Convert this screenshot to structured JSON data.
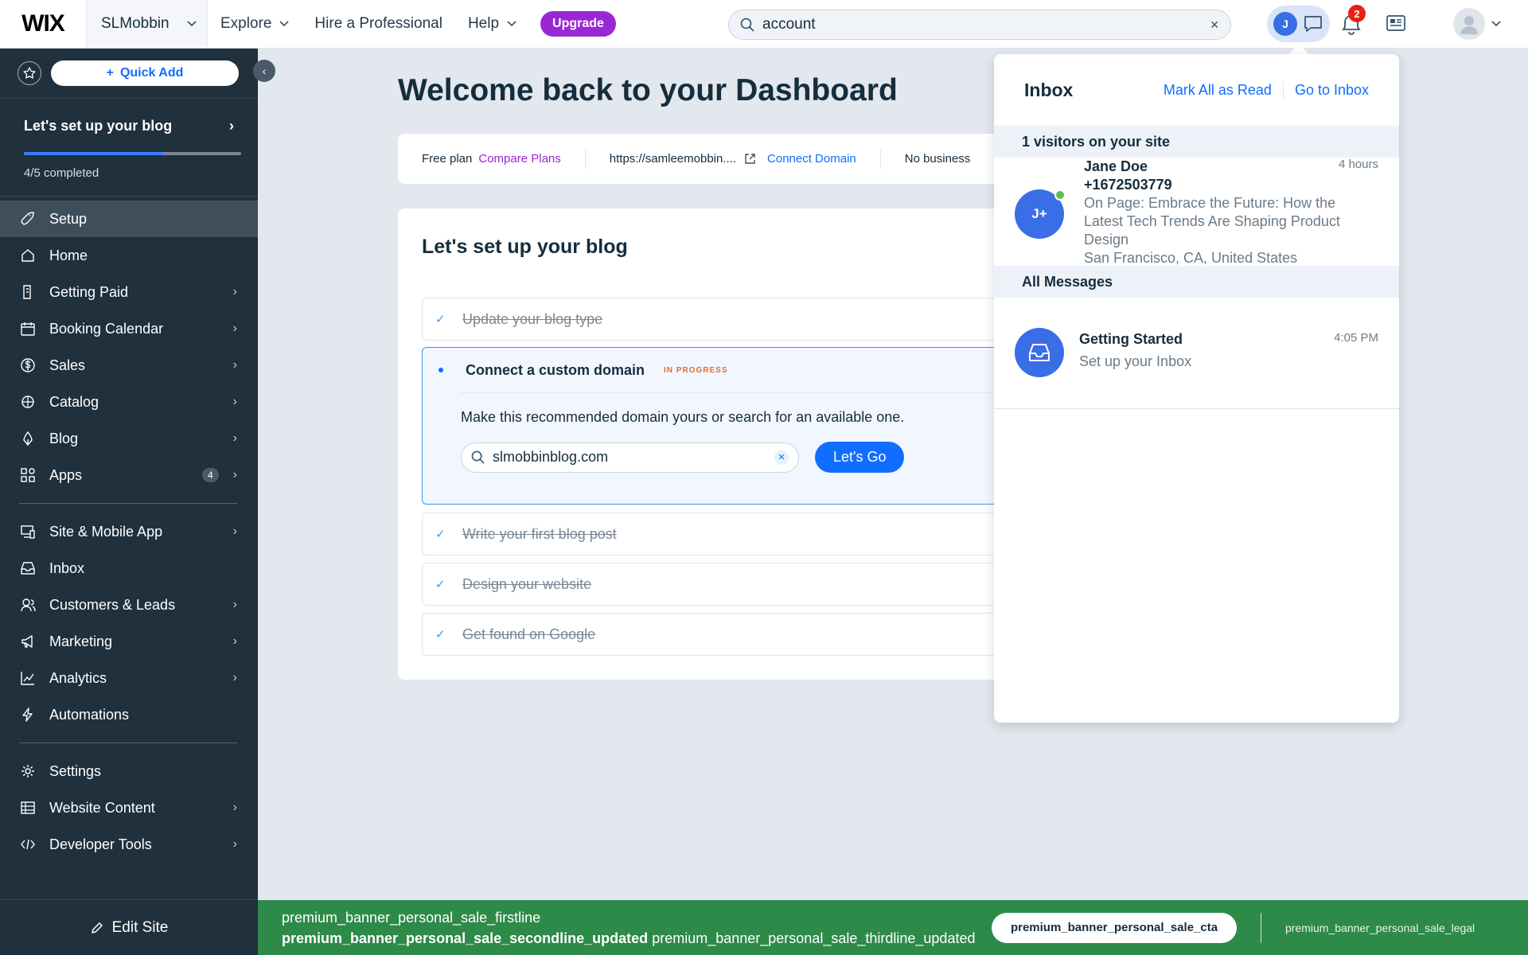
{
  "topbar": {
    "logo": "WIX",
    "site_name": "SLMobbin",
    "nav": [
      {
        "label": "Explore",
        "has_menu": true
      },
      {
        "label": "Hire a Professional",
        "has_menu": false
      },
      {
        "label": "Help",
        "has_menu": true
      }
    ],
    "upgrade_label": "Upgrade",
    "search_value": "account",
    "chat_avatar_initial": "J",
    "notification_count": "2"
  },
  "sidebar": {
    "quick_add_label": "Quick Add",
    "setup_title": "Let's set up your blog",
    "progress_fraction": 0.8,
    "progress_text": "4/5 completed",
    "items": [
      {
        "label": "Setup",
        "icon": "rocket-icon",
        "chevron": false,
        "active": true
      },
      {
        "label": "Home",
        "icon": "home-icon",
        "chevron": false
      },
      {
        "label": "Getting Paid",
        "icon": "getting-paid-icon",
        "chevron": true
      },
      {
        "label": "Booking Calendar",
        "icon": "calendar-icon",
        "chevron": true
      },
      {
        "label": "Sales",
        "icon": "dollar-icon",
        "chevron": true
      },
      {
        "label": "Catalog",
        "icon": "catalog-icon",
        "chevron": true
      },
      {
        "label": "Blog",
        "icon": "pen-nib-icon",
        "chevron": true
      },
      {
        "label": "Apps",
        "icon": "apps-icon",
        "chevron": true,
        "badge": "4"
      },
      {
        "label": "Site & Mobile App",
        "icon": "devices-icon",
        "chevron": true
      },
      {
        "label": "Inbox",
        "icon": "inbox-icon",
        "chevron": false
      },
      {
        "label": "Customers & Leads",
        "icon": "customers-icon",
        "chevron": true
      },
      {
        "label": "Marketing",
        "icon": "megaphone-icon",
        "chevron": true
      },
      {
        "label": "Analytics",
        "icon": "chart-icon",
        "chevron": true
      },
      {
        "label": "Automations",
        "icon": "bolt-icon",
        "chevron": false
      },
      {
        "label": "Settings",
        "icon": "gear-icon",
        "chevron": false
      },
      {
        "label": "Website Content",
        "icon": "table-icon",
        "chevron": true
      },
      {
        "label": "Developer Tools",
        "icon": "code-icon",
        "chevron": true
      }
    ],
    "edit_site_label": "Edit Site"
  },
  "main": {
    "welcome": "Welcome back to your Dashboard",
    "plan": {
      "free_plan": "Free plan",
      "compare_plans": "Compare Plans",
      "site_url": "https://samleemobbin....",
      "connect_domain": "Connect Domain",
      "business_info": "No business"
    },
    "setup_panel": {
      "title": "Let's set up your blog",
      "tasks": [
        {
          "label": "Update your blog type",
          "done": true
        },
        {
          "label": "Write your first blog post",
          "done": true
        },
        {
          "label": "Design your website",
          "done": true
        },
        {
          "label": "Get found on Google",
          "done": true
        }
      ],
      "active_task": {
        "label": "Connect a custom domain",
        "status": "IN PROGRESS",
        "description": "Make this recommended domain yours or search for an available one.",
        "domain_value": "slmobbinblog.com",
        "button": "Let's Go"
      }
    }
  },
  "inbox": {
    "title": "Inbox",
    "mark_all_read": "Mark All as Read",
    "go_to_inbox": "Go to Inbox",
    "visitors_header": "1 visitors on your site",
    "visitor": {
      "initials": "J+",
      "name": "Jane Doe",
      "phone": "+1672503779",
      "time": "4 hours",
      "page": "On Page: Embrace the Future: How the Latest Tech Trends Are Shaping Product Design",
      "location": "San Francisco, CA, United States"
    },
    "messages_header": "All Messages",
    "message": {
      "title": "Getting Started",
      "subtitle": "Set up your Inbox",
      "time": "4:05 PM"
    }
  },
  "banner": {
    "firstline": "premium_banner_personal_sale_firstline",
    "secondline": "premium_banner_personal_sale_secondline_updated",
    "thirdline": "premium_banner_personal_sale_thirdline_updated",
    "cta": "premium_banner_personal_sale_cta",
    "legal": "premium_banner_personal_sale_legal"
  }
}
